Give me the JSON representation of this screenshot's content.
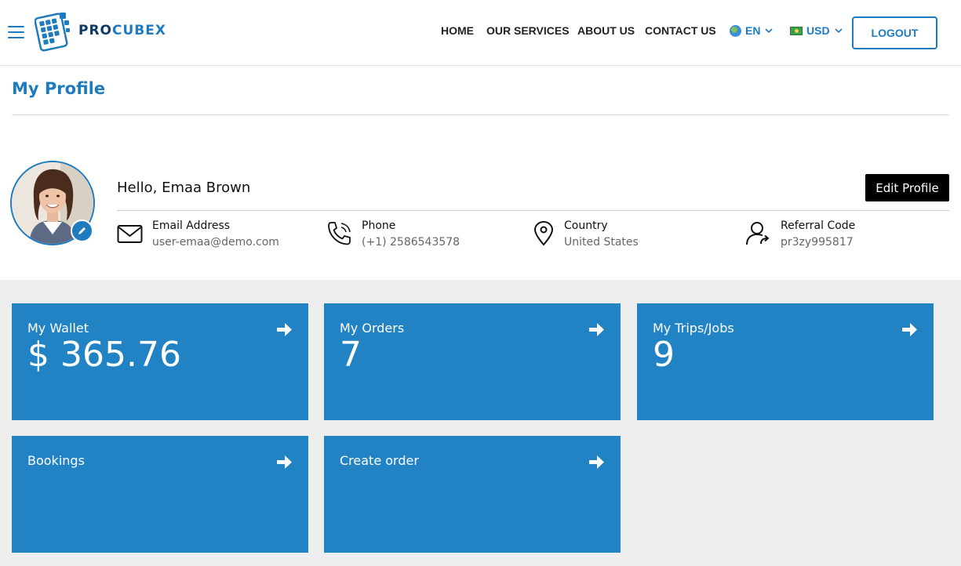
{
  "brand": {
    "pro": "PRO",
    "cubex": "CUBEX"
  },
  "nav": {
    "home": "HOME",
    "services": "OUR SERVICES",
    "about": "ABOUT US",
    "contact": "CONTACT US"
  },
  "language": {
    "selected": "EN",
    "icon": "globe-icon"
  },
  "currency": {
    "selected": "USD",
    "icon": "banknote-icon"
  },
  "logout_label": "LOGOUT",
  "page_title": "My Profile",
  "profile": {
    "greeting": "Hello, Emaa Brown",
    "edit_label": "Edit Profile",
    "email": {
      "label": "Email Address",
      "value": "user-emaa@demo.com"
    },
    "phone": {
      "label": "Phone",
      "value": "(+1) 2586543578"
    },
    "country": {
      "label": "Country",
      "value": "United States"
    },
    "referral": {
      "label": "Referral Code",
      "value": "pr3zy995817"
    }
  },
  "cards": [
    {
      "title": "My Wallet",
      "value": "$ 365.76"
    },
    {
      "title": "My Orders",
      "value": "7"
    },
    {
      "title": "My Trips/Jobs",
      "value": "9"
    },
    {
      "title": "Bookings",
      "value": ""
    },
    {
      "title": "Create order",
      "value": ""
    }
  ],
  "colors": {
    "accent": "#1e7bbf",
    "card": "#2283c4",
    "navy": "#0b3b66",
    "dash_bg": "#eeeeee"
  }
}
